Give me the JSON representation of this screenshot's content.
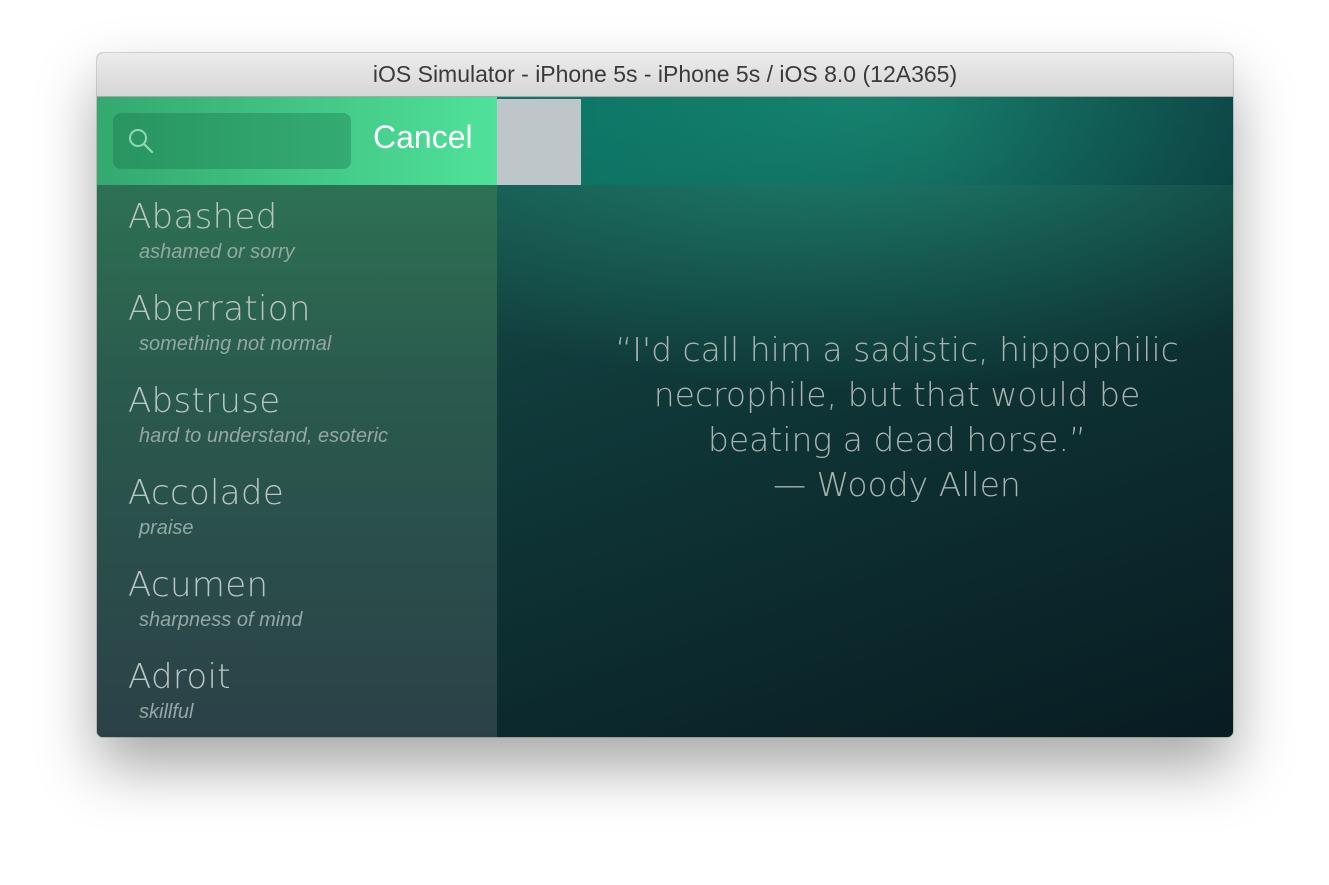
{
  "window": {
    "title": "iOS Simulator - iPhone 5s - iPhone 5s / iOS 8.0 (12A365)"
  },
  "search": {
    "placeholder": "",
    "value": "",
    "icon": "search-icon",
    "cancel_label": "Cancel"
  },
  "words": [
    {
      "word": "Abashed",
      "definition": "ashamed or sorry"
    },
    {
      "word": "Aberration",
      "definition": "something not normal"
    },
    {
      "word": "Abstruse",
      "definition": "hard to understand, esoteric"
    },
    {
      "word": "Accolade",
      "definition": "praise"
    },
    {
      "word": "Acumen",
      "definition": "sharpness of mind"
    },
    {
      "word": "Adroit",
      "definition": "skillful"
    }
  ],
  "quote": {
    "line1": "“I'd call him a sadistic, hippophilic",
    "line2": "necrophile, but that would be",
    "line3": "beating a dead horse.”",
    "author": "— Woody Allen"
  },
  "colors": {
    "accent_green": "#4fe29a",
    "panel_top": "#2f7b58",
    "panel_bottom": "#2b4148"
  }
}
